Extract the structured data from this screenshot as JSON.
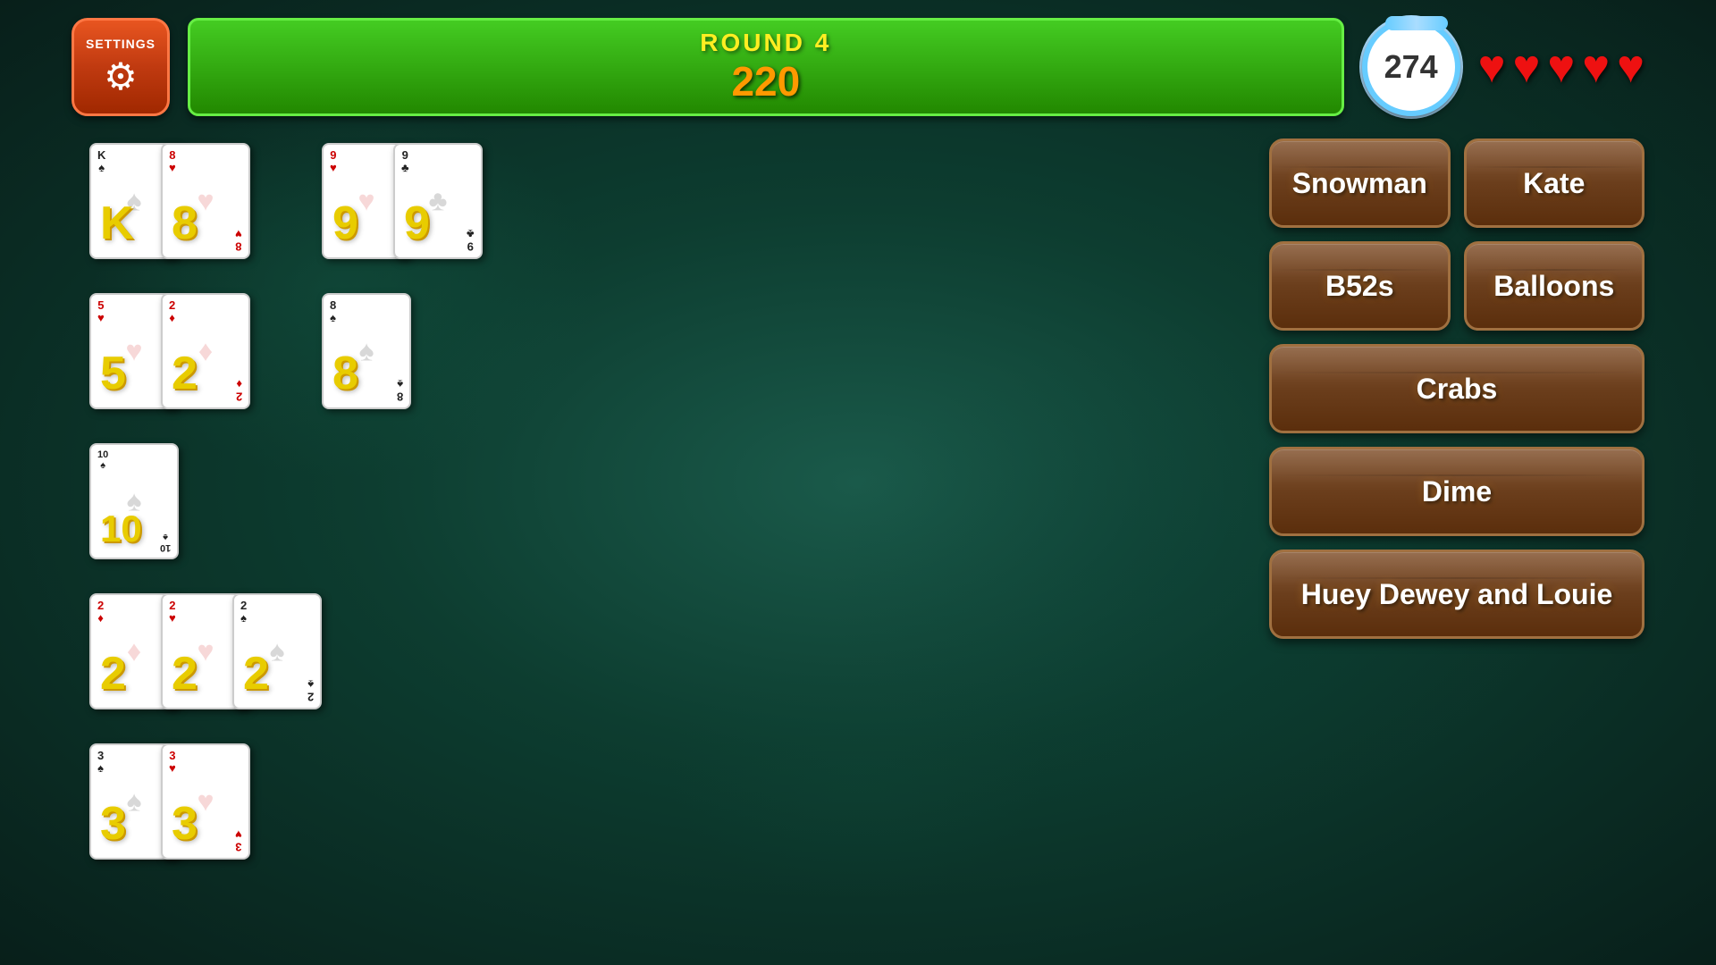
{
  "header": {
    "settings_label": "SETTINGS",
    "round_label": "ROUND 4",
    "score": "220",
    "timer": "274",
    "hearts_count": 5
  },
  "cards": {
    "rows": [
      {
        "cards": [
          {
            "value": "K",
            "suit": "spade",
            "suit_symbol": "♠",
            "color": "black",
            "corner": "K"
          },
          {
            "value": "8",
            "suit": "heart",
            "suit_symbol": "♥",
            "color": "red",
            "corner": "8"
          }
        ]
      },
      {
        "cards": [
          {
            "value": "9",
            "suit": "heart",
            "suit_symbol": "♥",
            "color": "red",
            "corner": "9"
          },
          {
            "value": "9",
            "suit": "club",
            "suit_symbol": "♣",
            "color": "black",
            "corner": "9"
          }
        ]
      },
      {
        "cards": [
          {
            "value": "5",
            "suit": "heart",
            "suit_symbol": "♥",
            "color": "red",
            "corner": "5"
          },
          {
            "value": "2",
            "suit": "diamond",
            "suit_symbol": "♦",
            "color": "red",
            "corner": "2"
          }
        ]
      },
      {
        "cards": [
          {
            "value": "8",
            "suit": "spade",
            "suit_symbol": "♠",
            "color": "black",
            "corner": "8"
          }
        ]
      },
      {
        "cards": [
          {
            "value": "10",
            "suit": "spade",
            "suit_symbol": "♠",
            "color": "black",
            "corner": "10"
          }
        ]
      },
      {
        "cards": [
          {
            "value": "2",
            "suit": "diamond",
            "suit_symbol": "♦",
            "color": "red",
            "corner": "2"
          },
          {
            "value": "2",
            "suit": "heart",
            "suit_symbol": "♥",
            "color": "red",
            "corner": "2"
          },
          {
            "value": "2",
            "suit": "spade",
            "suit_symbol": "♠",
            "color": "black",
            "corner": "2"
          }
        ]
      },
      {
        "cards": [
          {
            "value": "3",
            "suit": "spade",
            "suit_symbol": "♠",
            "color": "black",
            "corner": "3"
          },
          {
            "value": "3",
            "suit": "heart",
            "suit_symbol": "♥",
            "color": "red",
            "corner": "3"
          }
        ]
      }
    ]
  },
  "name_buttons": [
    {
      "id": "snowman",
      "label": "Snowman",
      "span": 1
    },
    {
      "id": "kate",
      "label": "Kate",
      "span": 1
    },
    {
      "id": "b52s",
      "label": "B52s",
      "span": 1
    },
    {
      "id": "balloons",
      "label": "Balloons",
      "span": 1
    },
    {
      "id": "crabs",
      "label": "Crabs",
      "span": 2
    },
    {
      "id": "dime",
      "label": "Dime",
      "span": 2
    },
    {
      "id": "huey_dewey_louie",
      "label": "Huey Dewey and Louie",
      "span": 2
    }
  ]
}
